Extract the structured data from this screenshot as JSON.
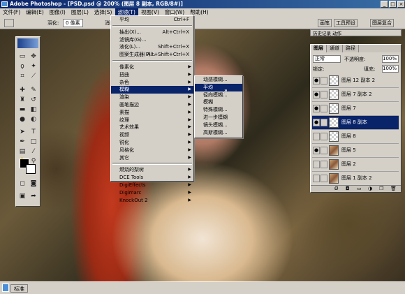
{
  "window": {
    "title": "Adobe Photoshop - [PSD.psd @ 200% (图层 8 副本, RGB/8#)]",
    "controls": [
      "_",
      "□",
      "×"
    ]
  },
  "menubar": [
    "文件(F)",
    "编辑(E)",
    "图像(I)",
    "图层(L)",
    "选择(S)",
    "滤镜(T)",
    "视图(V)",
    "窗口(W)",
    "帮助(H)"
  ],
  "options": {
    "feather_label": "羽化:",
    "feather_value": "0 像素",
    "antialias": "消除锯齿"
  },
  "top_palette_tabs": [
    "画笔",
    "工具预设",
    "图层复合"
  ],
  "filter_menu": {
    "top": [
      {
        "label": "平均",
        "shortcut": "Ctrl+F"
      }
    ],
    "mid": [
      {
        "label": "抽出(X)...",
        "shortcut": "Alt+Ctrl+X"
      },
      {
        "label": "滤镜库(G)...",
        "shortcut": ""
      },
      {
        "label": "液化(L)...",
        "shortcut": "Shift+Ctrl+X"
      },
      {
        "label": "图案生成器(P)...",
        "shortcut": "Alt+Shift+Ctrl+X"
      }
    ],
    "groups": [
      "像素化",
      "扭曲",
      "杂色",
      "模糊",
      "渲染",
      "画笔描边",
      "素描",
      "纹理",
      "艺术效果",
      "视频",
      "锐化",
      "风格化",
      "其它"
    ],
    "plugins": [
      "燃烧的梨树",
      "DCE Tools",
      "DigiEffects",
      "Digimarc",
      "KnockOut 2"
    ]
  },
  "blur_submenu": [
    "动感模糊...",
    "平均",
    "径向模糊...",
    "模糊",
    "特殊模糊...",
    "进一步模糊",
    "镜头模糊...",
    "高斯模糊..."
  ],
  "layers_panel": {
    "mini_tab": "历史记录 动作",
    "tabs": [
      "图层",
      "通道",
      "路径"
    ],
    "mode": "正常",
    "opacity_label": "不透明度:",
    "opacity": "100%",
    "lock_label": "锁定:",
    "fill_label": "填充:",
    "fill": "100%",
    "layers": [
      "图层 12 副本 2",
      "图层 7 副本 2",
      "图层 7",
      "图层 8 副本",
      "图层 8",
      "图层 5",
      "图层 2",
      "图层 1 副本 2"
    ],
    "selected_index": 3
  },
  "status": {
    "mode_label": "标准"
  }
}
